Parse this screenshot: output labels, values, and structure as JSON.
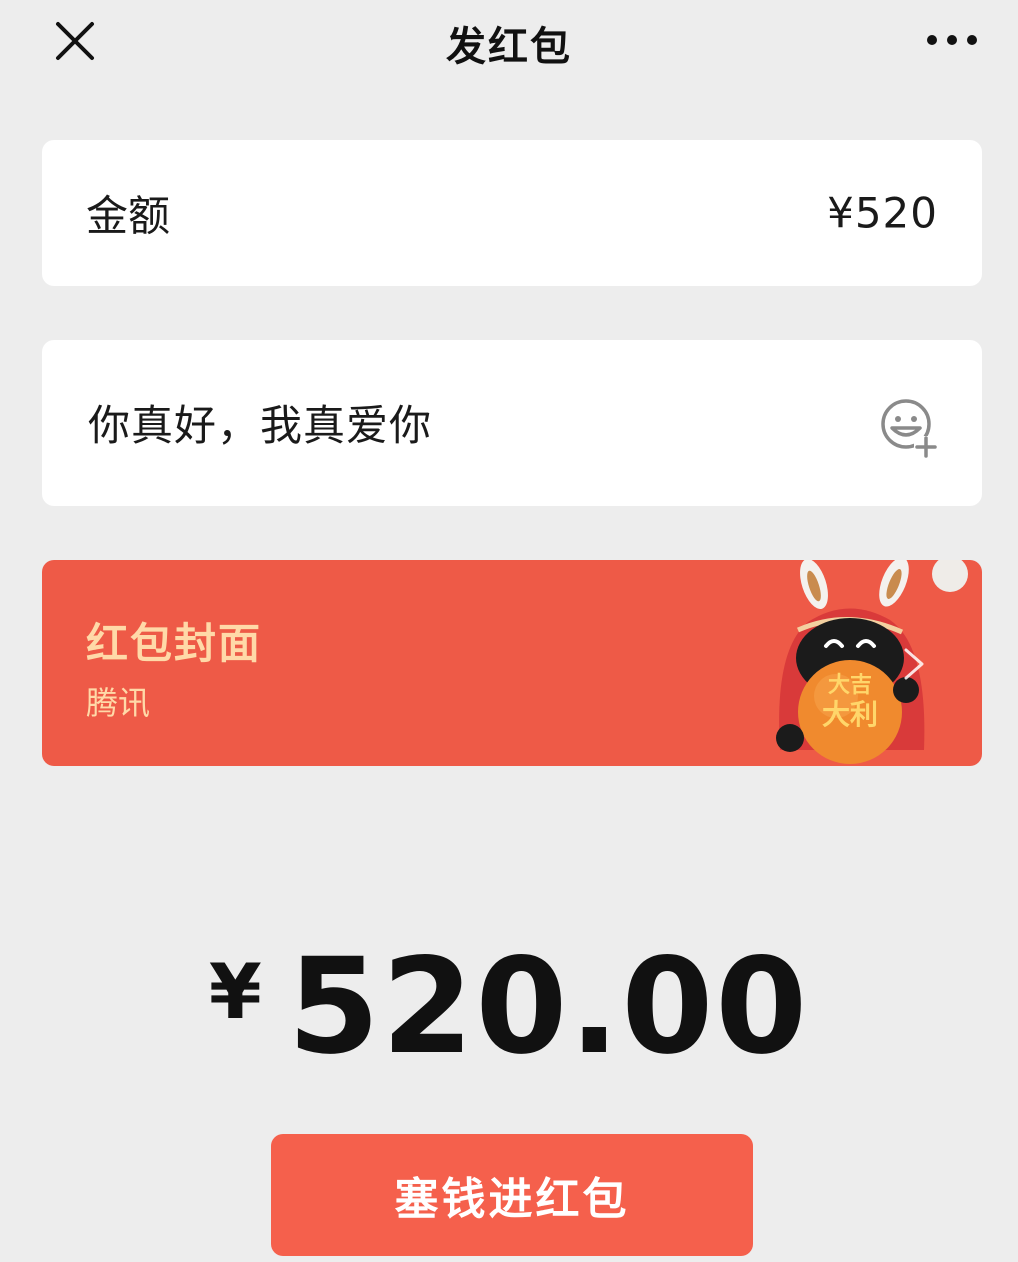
{
  "header": {
    "title": "发红包",
    "close_icon": "close-icon",
    "more_icon": "more-icon"
  },
  "amount": {
    "label": "金额",
    "value": "¥520"
  },
  "message": {
    "text": "你真好，我真爱你",
    "emoji_icon": "emoji-add-icon"
  },
  "cover": {
    "title": "红包封面",
    "subtitle": "腾讯",
    "mascot_text": "大吉大利",
    "chevron_icon": "chevron-right-icon",
    "background": "#ee5a47",
    "text_color": "#ffd9a8"
  },
  "total": {
    "currency": "¥",
    "value": "520.00"
  },
  "submit": {
    "label": "塞钱进红包",
    "color": "#f5604c"
  }
}
